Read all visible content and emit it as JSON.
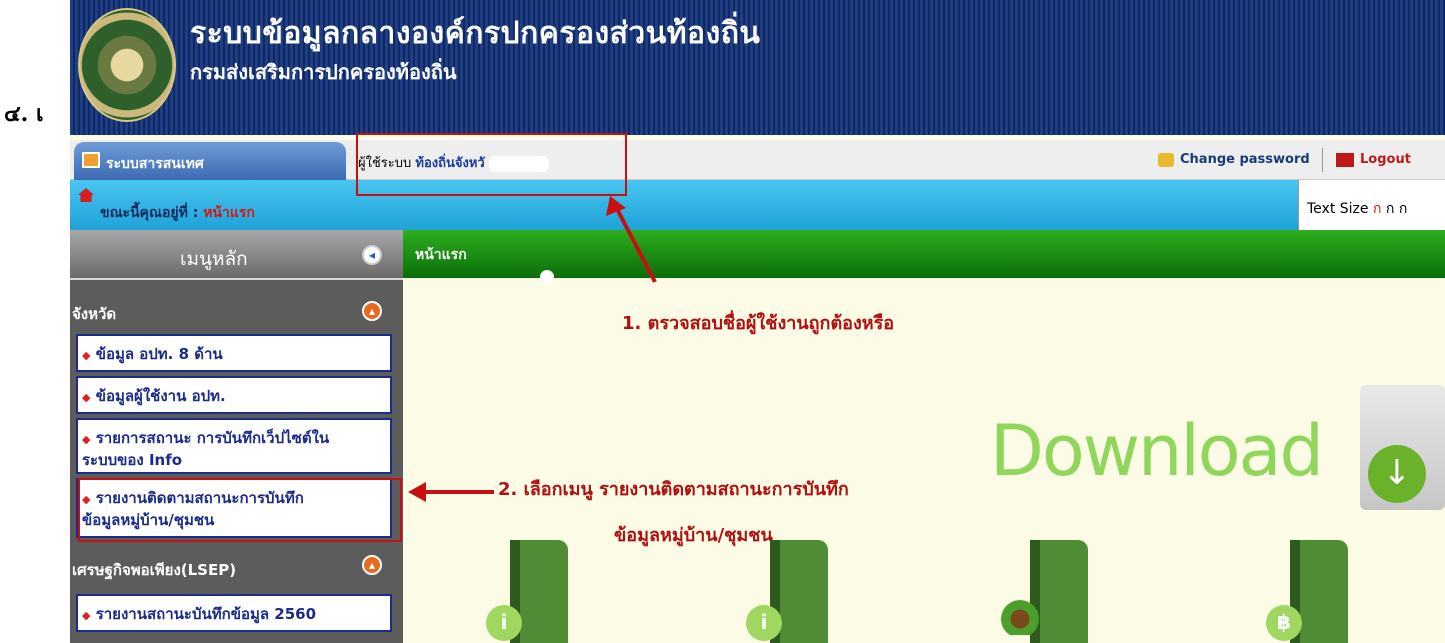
{
  "document": {
    "step_prefix": "๔. เ"
  },
  "header": {
    "title": "ระบบข้อมูลกลางองค์กรปกครองส่วนท้องถิ่น",
    "subtitle": "กรมส่งเสริมการปกครองท้องถิ่น",
    "logo_icon": "department-seal-logo"
  },
  "topbar": {
    "tab_label": "ระบบสารสนเทศ",
    "user_prefix": "ผู้ใช้ระบบ",
    "user_name": "ท้องถิ่นจังหวั",
    "change_password": "Change password",
    "logout": "Logout"
  },
  "breadcrumb": {
    "label": "ขณะนี้คุณอยู่ที่ :",
    "value": "หน้าแรก"
  },
  "text_size": {
    "label": "Text Size",
    "options": [
      "ก",
      "ก",
      "ก"
    ]
  },
  "menu": {
    "header": "เมนูหลัก",
    "groups": [
      {
        "label": "จังหวัด"
      },
      {
        "label": "เศรษฐกิจพอเพียง(LSEP)"
      }
    ],
    "items": [
      "ข้อมูล อปท. 8 ด้าน",
      "ข้อมูลผู้ใช้งาน อปท.",
      "รายการสถานะ การบันทึกเว็ปไซต์ใน",
      "ระบบของ Info",
      "รายงานติดตามสถานะการบันทึก",
      "ข้อมูลหมู่บ้าน/ชุมชน",
      "รายงานสถานะบันทึกข้อมูล 2560"
    ]
  },
  "content": {
    "header": "หน้าแรก",
    "annotation_1": "1. ตรวจสอบชื่อผู้ใช้งานถูกต้องหรือ",
    "annotation_2_line1": "2. เลือกเมนู รายงานติดตามสถานะการบันทึก",
    "annotation_2_line2": "ข้อมูลหมู่บ้าน/ชุมชน",
    "download_label": "Download",
    "icons": [
      "info-book-icon",
      "info-book-icon",
      "palm-book-icon",
      "baht-book-icon"
    ]
  },
  "colors": {
    "banner": "#1e3f86",
    "breadcrumb_bar": "#20a2d8",
    "content_header": "#0b6e0b",
    "annotation": "#b01010",
    "download": "#8fd65a"
  }
}
